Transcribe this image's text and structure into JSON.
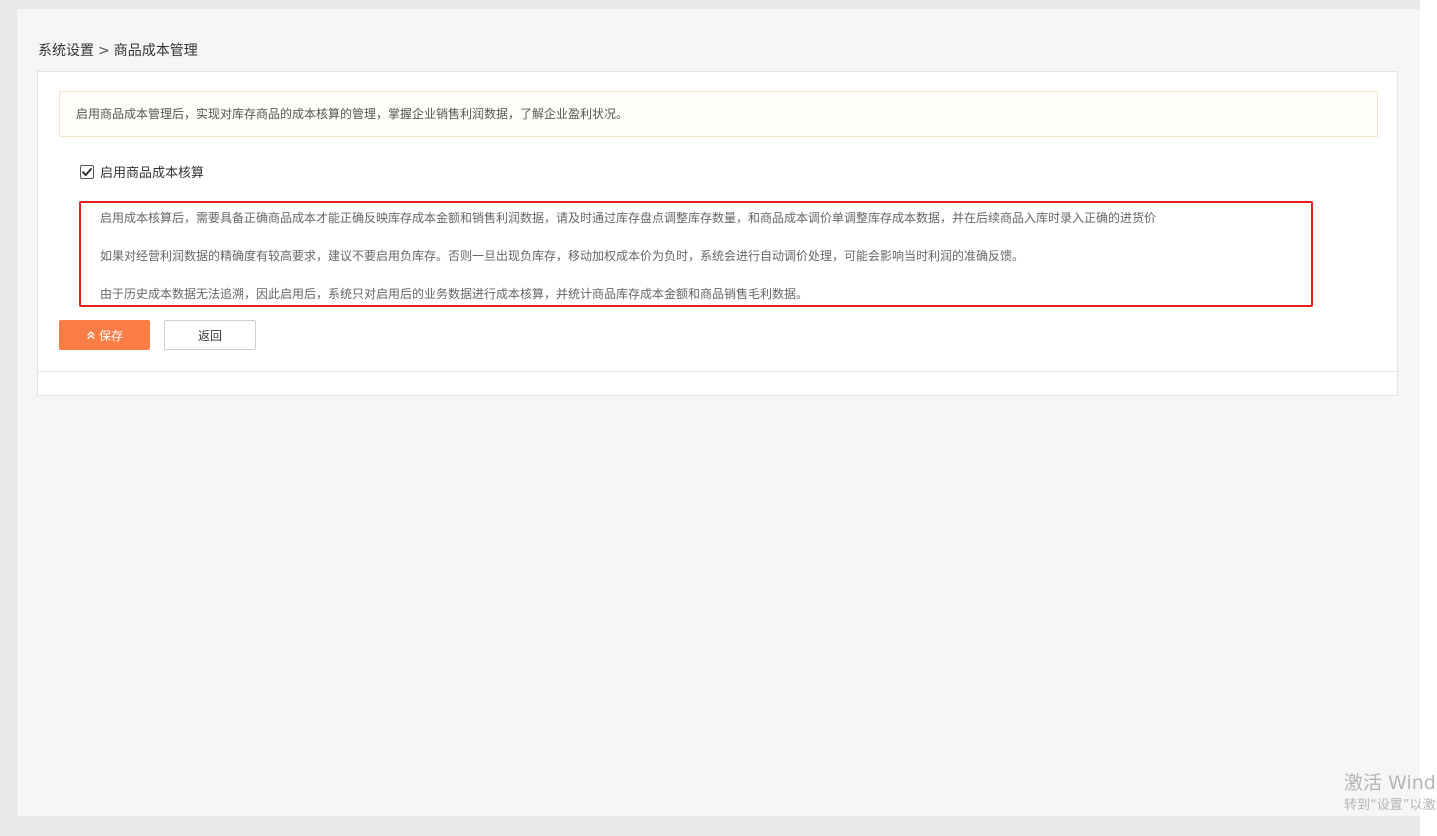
{
  "breadcrumb": {
    "parent": "系统设置",
    "separator": ">",
    "current": "商品成本管理"
  },
  "notice": {
    "text": "启用商品成本管理后，实现对库存商品的成本核算的管理，掌握企业销售利润数据，了解企业盈利状况。"
  },
  "setting": {
    "checkbox_label": "启用商品成本核算",
    "checked": true
  },
  "description": {
    "lines": [
      "启用成本核算后，需要具备正确商品成本才能正确反映库存成本金额和销售利润数据，请及时通过库存盘点调整库存数量，和商品成本调价单调整库存成本数据，并在后续商品入库时录入正确的进货价",
      "如果对经营利润数据的精确度有较高要求，建议不要启用负库存。否则一旦出现负库存，移动加权成本价为负时，系统会进行自动调价处理，可能会影响当时利润的准确反馈。",
      "由于历史成本数据无法追溯，因此启用后，系统只对启用后的业务数据进行成本核算，并统计商品库存成本金额和商品销售毛利数据。"
    ]
  },
  "buttons": {
    "save_label": "保存",
    "back_label": "返回"
  },
  "watermark": {
    "line1": "激活 Windows",
    "line2": "转到“设置”以激活 Windows。"
  },
  "colors": {
    "accent": "#fa7d45",
    "highlight_border": "#e5211d",
    "notice_bg": "#fffdf9"
  },
  "icons": {
    "save": "double-chevron-up-icon",
    "checkbox": "checkmark-icon"
  }
}
